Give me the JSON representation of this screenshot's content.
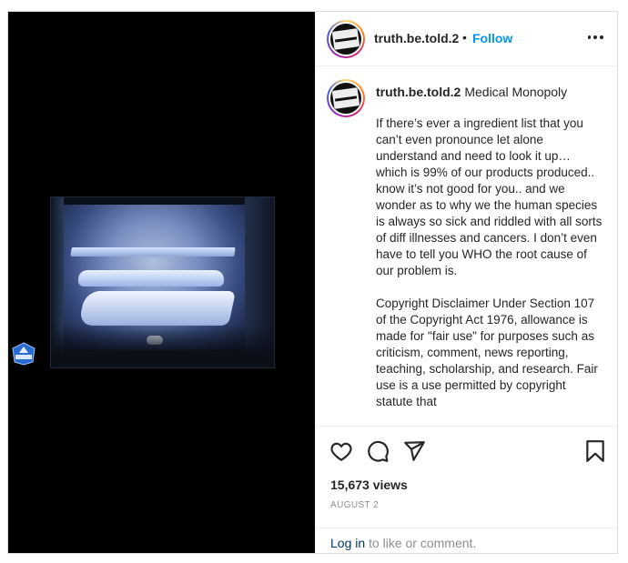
{
  "post": {
    "author": "truth.be.told.2",
    "dot": "•",
    "follow_label": "Follow",
    "caption_title": "Medical Monopoly",
    "caption_body": "If there’s ever a ingredient list that you can’t even pronounce let alone understand and need to look it up… which is 99% of our products produced.. know it’s not good for you.. and we wonder as to why we the human species is always so sick and riddled with all sorts of diff illnesses and cancers. I don’t even have to tell you WHO the root cause of our problem is.\n\nCopyright Disclaimer Under Section 107 of the Copyright Act 1976, allowance is made for \"fair use\" for purposes such as criticism, comment, news reporting, teaching, scholarship, and research. Fair use is a use permitted by copyright statute that",
    "views": "15,673 views",
    "date": "AUGUST 2",
    "login_link": "Log in",
    "login_suffix": " to like or comment."
  },
  "icons": {
    "avatar": "avatar-logo",
    "more": "more-options-icon",
    "like": "heart-icon",
    "comment": "comment-bubble-icon",
    "share": "send-paper-plane-icon",
    "save": "bookmark-icon"
  },
  "colors": {
    "follow": "#0095f6",
    "link": "#00376b",
    "muted": "#8e8e8e",
    "border": "#dbdbdb"
  }
}
